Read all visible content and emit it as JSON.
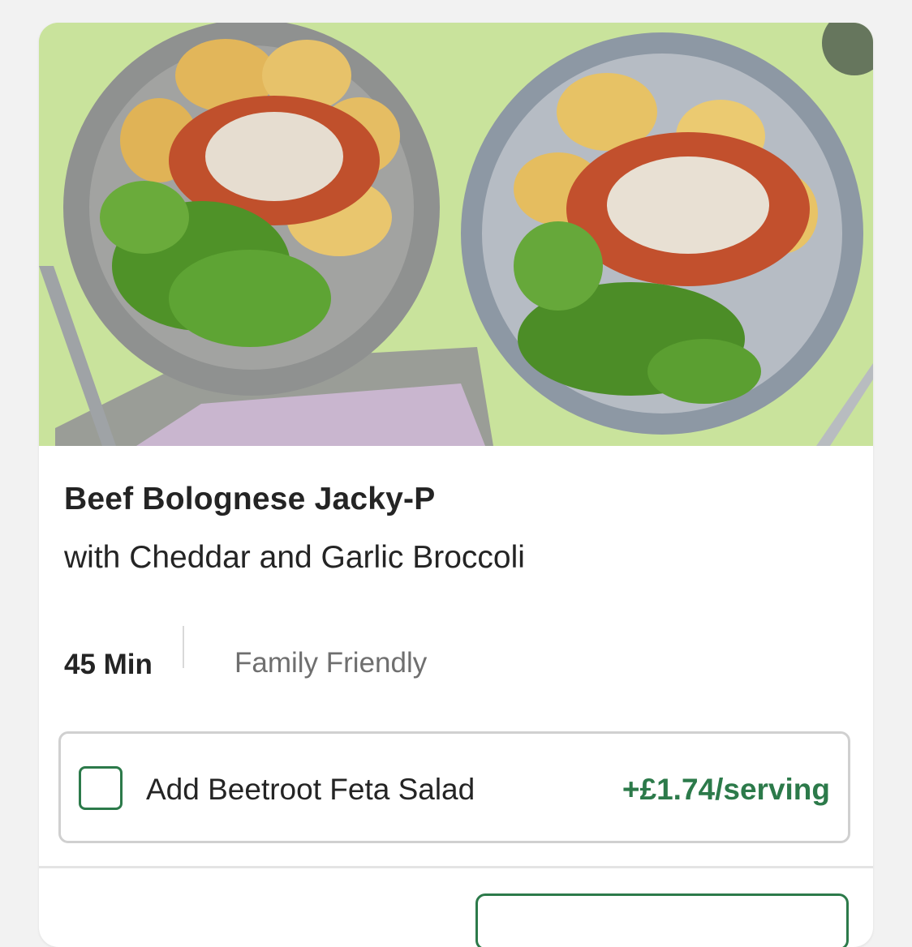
{
  "recipe": {
    "title": "Beef Bolognese Jacky-P",
    "subtitle": "with Cheddar and Garlic Broccoli",
    "time": "45 Min",
    "tag": "Family Friendly"
  },
  "addon": {
    "label": "Add Beetroot Feta Salad",
    "price": "+£1.74/serving",
    "checked": false
  },
  "colors": {
    "accent_green": "#2c7a4a",
    "text_primary": "#242424",
    "text_secondary": "#6f6f6f",
    "hero_background": "#c8e39b"
  },
  "icons": {
    "checkbox": "empty-checkbox-icon"
  }
}
